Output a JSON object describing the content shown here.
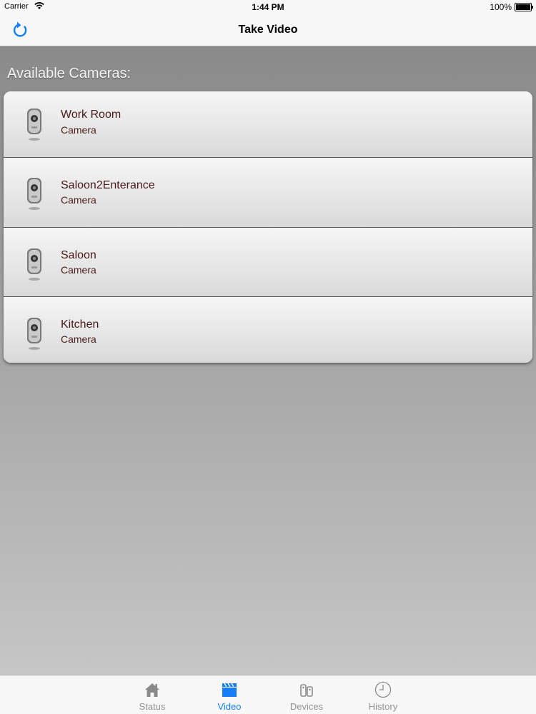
{
  "status_bar": {
    "carrier": "Carrier",
    "time": "1:44 PM",
    "battery": "100%"
  },
  "nav_bar": {
    "title": "Take Video",
    "refresh_icon": "refresh-icon"
  },
  "content": {
    "section_title": "Available Cameras:",
    "cameras": [
      {
        "name": "Work Room",
        "type": "Camera",
        "icon": "camera-icon"
      },
      {
        "name": "Saloon2Enterance",
        "type": "Camera",
        "icon": "camera-icon"
      },
      {
        "name": "Saloon",
        "type": "Camera",
        "icon": "camera-icon"
      },
      {
        "name": "Kitchen",
        "type": "Camera",
        "icon": "camera-icon"
      }
    ]
  },
  "tab_bar": {
    "tabs": [
      {
        "label": "Status",
        "icon": "home-icon",
        "active": false
      },
      {
        "label": "Video",
        "icon": "clapperboard-icon",
        "active": true
      },
      {
        "label": "Devices",
        "icon": "devices-icon",
        "active": false
      },
      {
        "label": "History",
        "icon": "clock-icon",
        "active": false
      }
    ]
  },
  "colors": {
    "accent": "#157efb",
    "inactive_tab": "#929292",
    "row_text": "#4a1a1a"
  }
}
